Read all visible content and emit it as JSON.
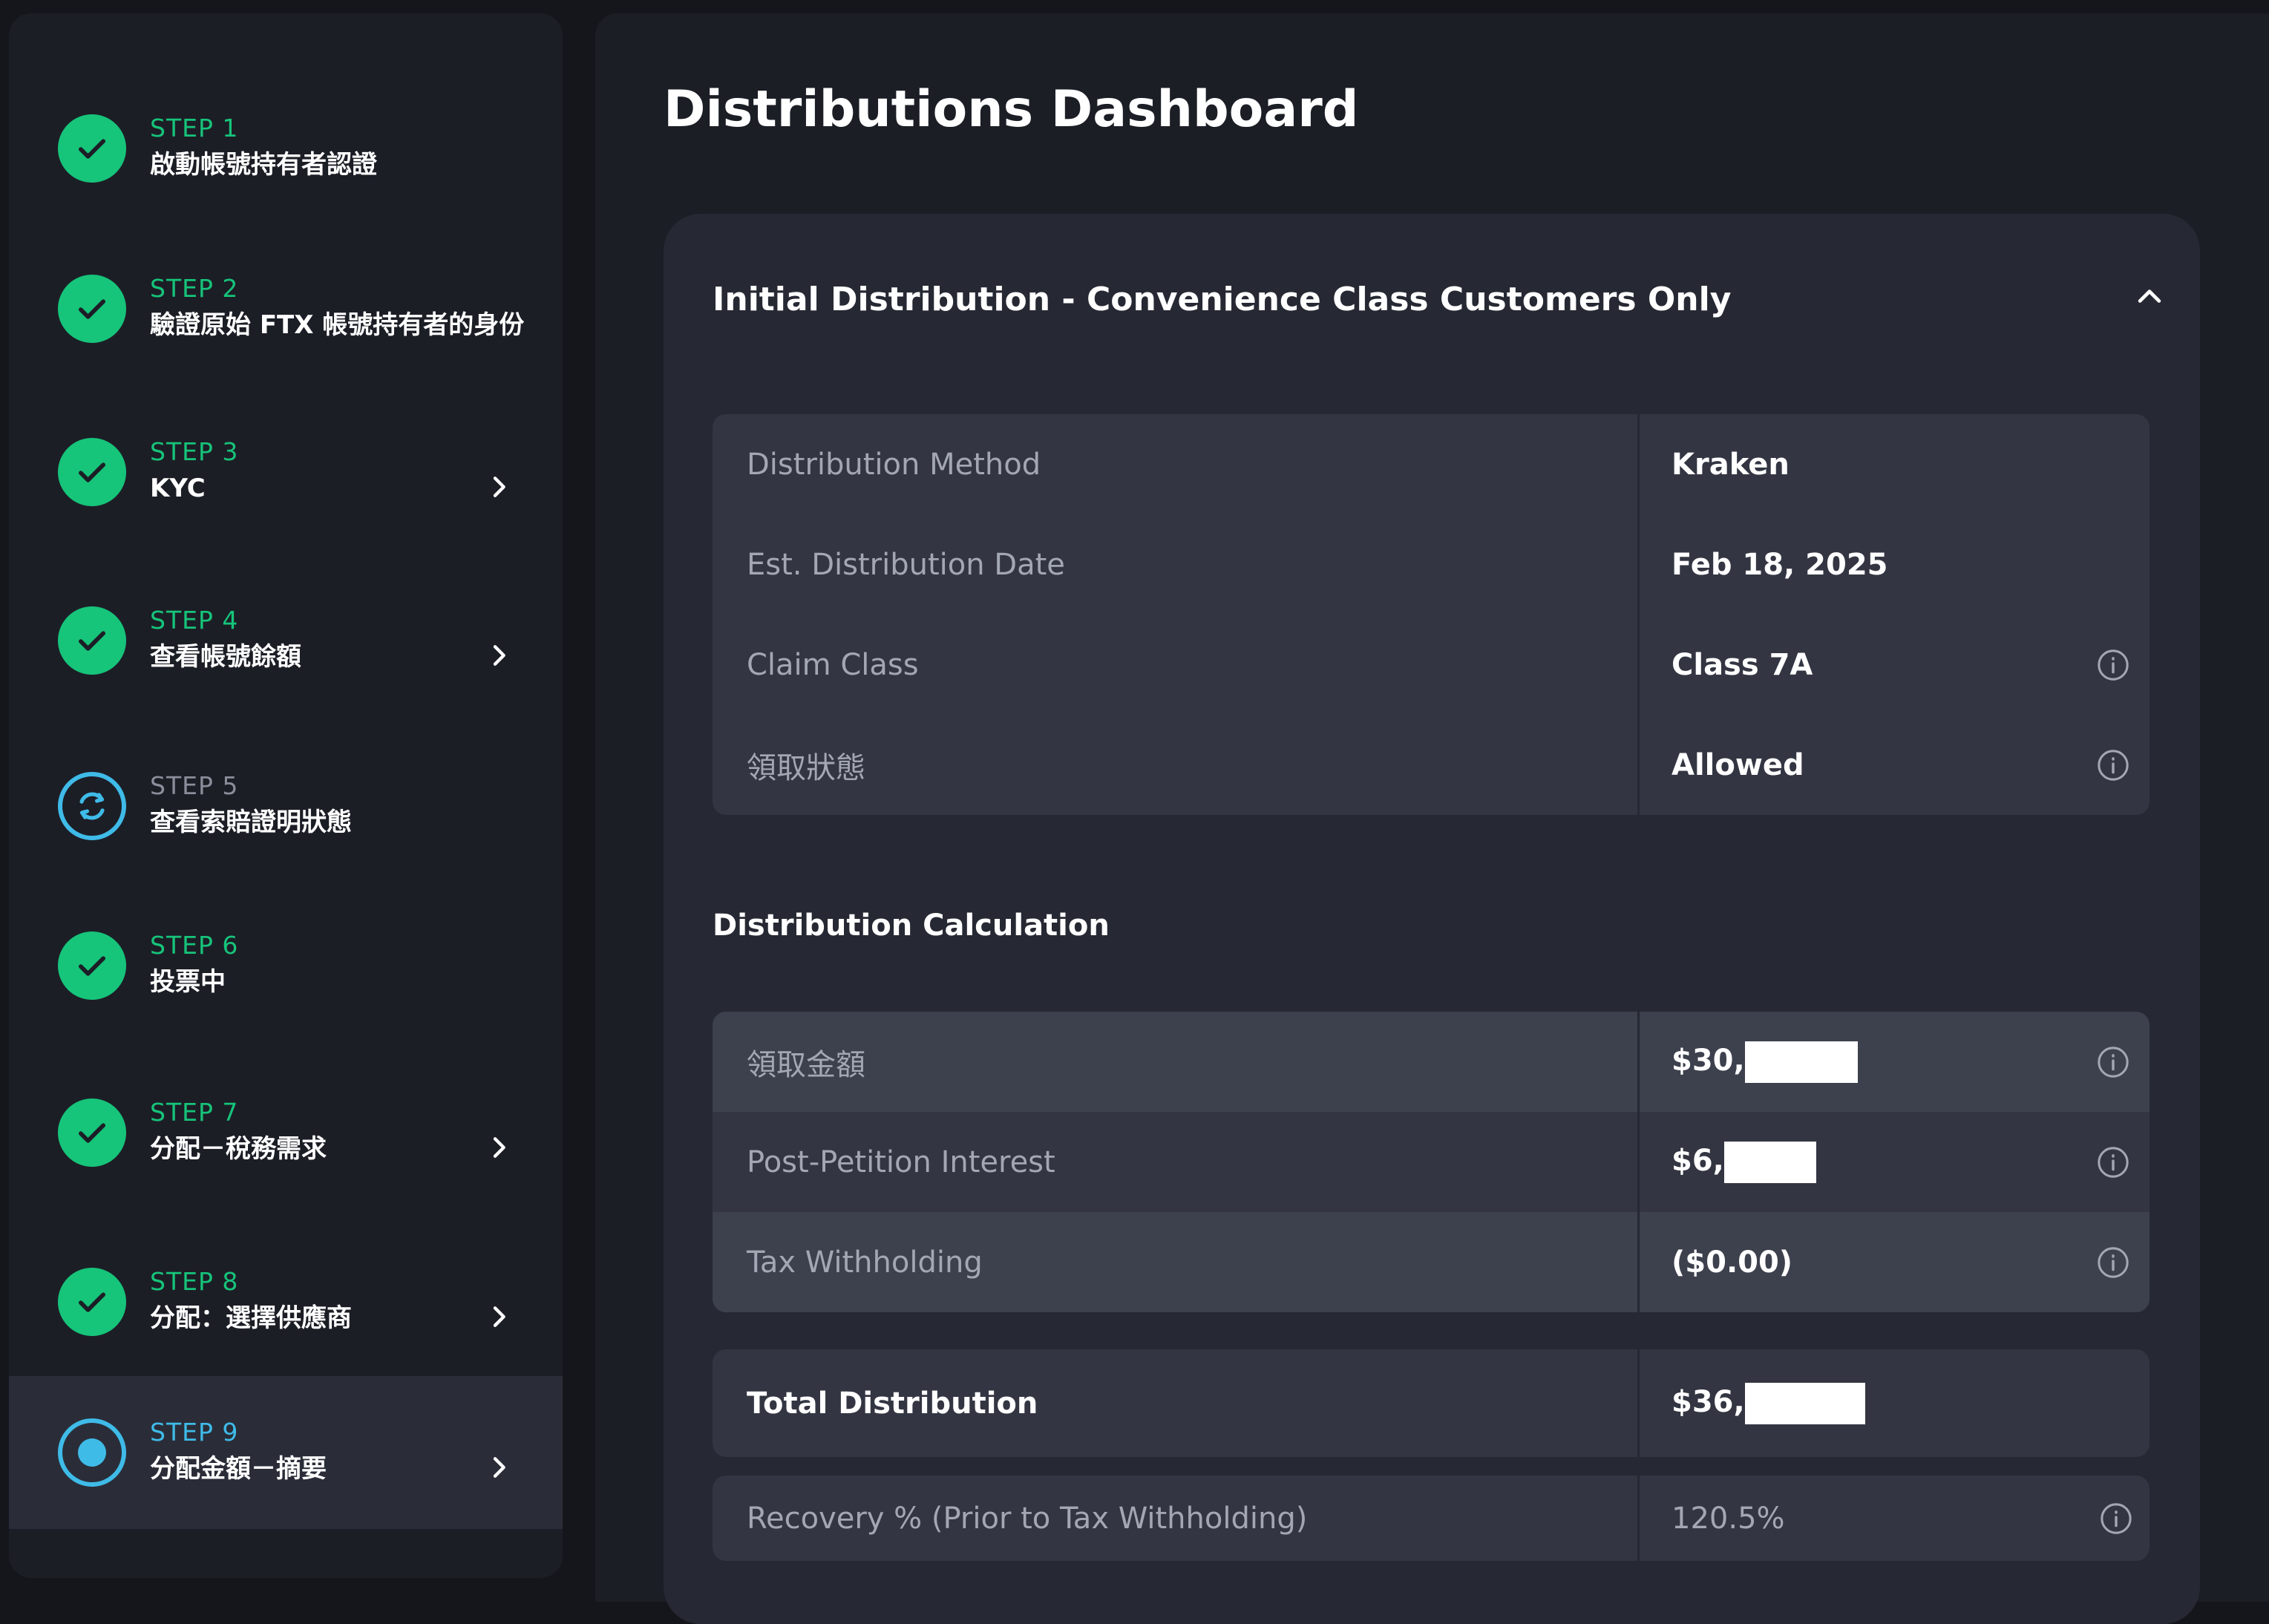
{
  "sidebar": {
    "steps": [
      {
        "num": "STEP 1",
        "title": "啟動帳號持有者認證",
        "status": "done",
        "chevron": false
      },
      {
        "num": "STEP 2",
        "title": "驗證原始 FTX 帳號持有者的身份",
        "status": "done",
        "chevron": false
      },
      {
        "num": "STEP 3",
        "title": "KYC",
        "status": "done",
        "chevron": true
      },
      {
        "num": "STEP 4",
        "title": "查看帳號餘額",
        "status": "done",
        "chevron": true
      },
      {
        "num": "STEP 5",
        "title": "查看索賠證明狀態",
        "status": "pending",
        "chevron": false
      },
      {
        "num": "STEP 6",
        "title": "投票中",
        "status": "done",
        "chevron": false
      },
      {
        "num": "STEP 7",
        "title": "分配－稅務需求",
        "status": "done",
        "chevron": true
      },
      {
        "num": "STEP 8",
        "title": "分配：選擇供應商",
        "status": "done",
        "chevron": true
      },
      {
        "num": "STEP 9",
        "title": "分配金額－摘要",
        "status": "current",
        "chevron": true
      }
    ]
  },
  "main": {
    "title": "Distributions Dashboard",
    "card": {
      "title": "Initial Distribution - Convenience Class Customers Only",
      "details": [
        {
          "label": "Distribution Method",
          "value": "Kraken"
        },
        {
          "label": "Est. Distribution Date",
          "value": "Feb 18, 2025"
        },
        {
          "label": "Claim Class",
          "value": "Class 7A"
        },
        {
          "label": "領取狀態",
          "value": "Allowed"
        }
      ],
      "calc_title": "Distribution Calculation",
      "calc": [
        {
          "label": "領取金額",
          "value": "$30,"
        },
        {
          "label": "Post-Petition Interest",
          "value": "$6,"
        },
        {
          "label": "Tax Withholding",
          "value": "($0.00)"
        }
      ],
      "total": {
        "label": "Total Distribution",
        "value": "$36,"
      },
      "recovery": {
        "label": "Recovery % (Prior to Tax Withholding)",
        "value": "120.5%"
      }
    }
  },
  "colors": {
    "success": "#16c47a",
    "accent": "#3fbbe8",
    "background": "#14161c",
    "panel": "#1c1e26"
  }
}
